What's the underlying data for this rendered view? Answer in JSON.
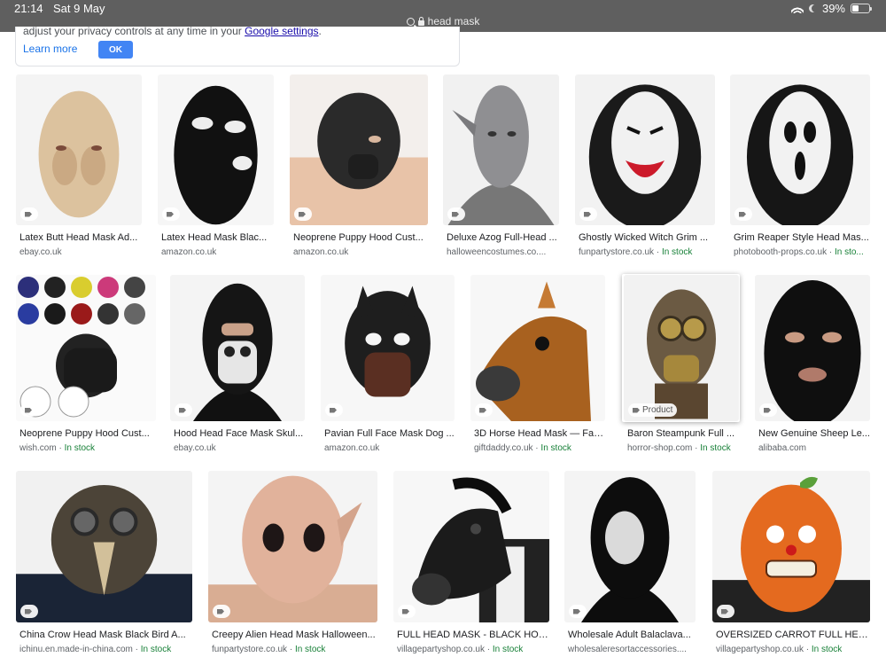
{
  "status_bar": {
    "time": "21:14",
    "date": "Sat 9 May",
    "url": "head mask",
    "battery": "39%",
    "battery_level": 0.39
  },
  "consent": {
    "text_before": "adjust your privacy controls at any time in your ",
    "link": "Google settings",
    "text_after": ".",
    "learn_more": "Learn more",
    "ok": "OK"
  },
  "stock_label": "In stock",
  "results": [
    {
      "title": "Latex Butt Head Mask Ad...",
      "source": "ebay.co.uk",
      "in_stock": false
    },
    {
      "title": "Latex Head Mask Blac...",
      "source": "amazon.co.uk",
      "in_stock": false
    },
    {
      "title": "Neoprene Puppy Hood Cust...",
      "source": "amazon.co.uk",
      "in_stock": false
    },
    {
      "title": "Deluxe Azog Full-Head ...",
      "source": "halloweencostumes.co....",
      "in_stock": false
    },
    {
      "title": "Ghostly Wicked Witch Grim ...",
      "source": "funpartystore.co.uk",
      "in_stock": true
    },
    {
      "title": "Grim Reaper Style Head Mas...",
      "source": "photobooth-props.co.uk",
      "in_stock": true,
      "stock_text": "In sto..."
    },
    {
      "title": "Neoprene Puppy Hood Cust...",
      "source": "wish.com",
      "in_stock": true
    },
    {
      "title": "Hood Head Face Mask Skul...",
      "source": "ebay.co.uk",
      "in_stock": false
    },
    {
      "title": "Pavian Full Face Mask Dog ...",
      "source": "amazon.co.uk",
      "in_stock": false
    },
    {
      "title": "3D Horse Head Mask — Fan...",
      "source": "giftdaddy.co.uk",
      "in_stock": true
    },
    {
      "title": "Baron Steampunk Full ...",
      "source": "horror-shop.com",
      "in_stock": true,
      "badge": "Product"
    },
    {
      "title": "New Genuine Sheep Le...",
      "source": "alibaba.com",
      "in_stock": false
    },
    {
      "title": "China Crow Head Mask Black Bird A...",
      "source": "ichinu.en.made-in-china.com",
      "in_stock": true
    },
    {
      "title": "Creepy Alien Head Mask Halloween...",
      "source": "funpartystore.co.uk",
      "in_stock": true
    },
    {
      "title": "FULL HEAD MASK - BLACK HOR...",
      "source": "villagepartyshop.co.uk",
      "in_stock": true
    },
    {
      "title": "Wholesale Adult Balaclava...",
      "source": "wholesaleresortaccessories....",
      "in_stock": false
    },
    {
      "title": "OVERSIZED CARROT FULL HEAD...",
      "source": "villagepartyshop.co.uk",
      "in_stock": true
    }
  ]
}
